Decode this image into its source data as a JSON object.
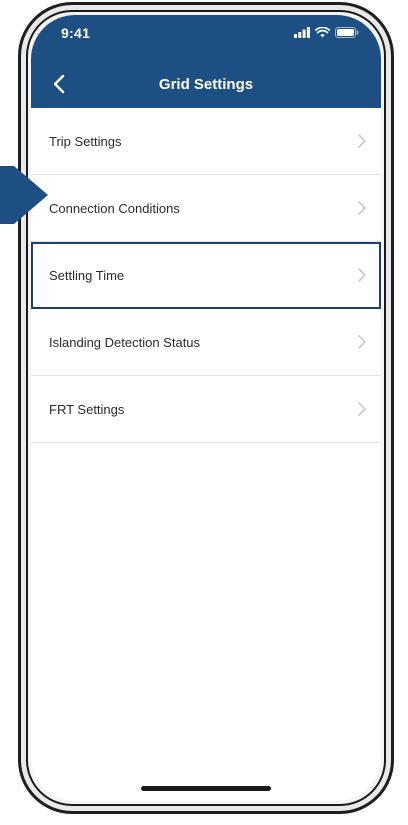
{
  "status_bar": {
    "time": "9:41"
  },
  "nav": {
    "title": "Grid Settings"
  },
  "settings": {
    "items": [
      {
        "label": "Trip Settings"
      },
      {
        "label": "Connection Conditions"
      },
      {
        "label": "Settling Time",
        "selected": true
      },
      {
        "label": "Islanding Detection Status"
      },
      {
        "label": "FRT Settings"
      }
    ]
  },
  "colors": {
    "header": "#1e4f82",
    "highlight_outline": "#1e3f6c",
    "callout_arrow": "#1e4f82"
  },
  "icons": {
    "back": "chevron-left-icon",
    "row": "chevron-right-icon",
    "status": [
      "signal-icon",
      "wifi-icon",
      "battery-icon"
    ]
  }
}
